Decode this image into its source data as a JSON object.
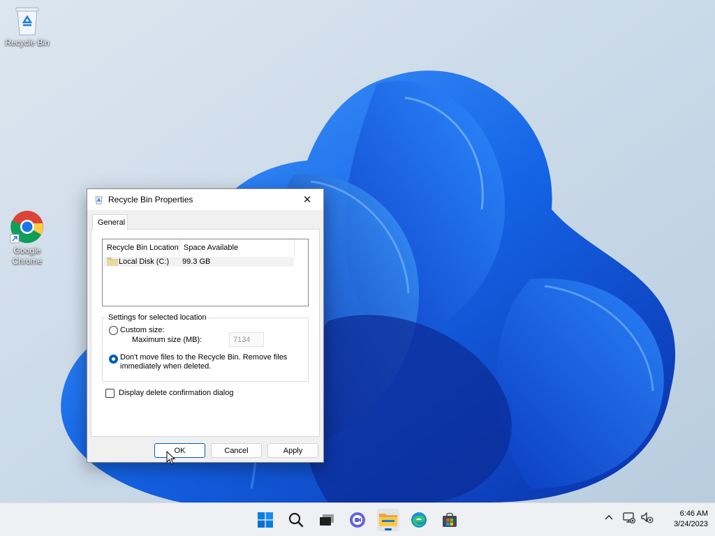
{
  "desktop": {
    "icons": [
      {
        "label": "Recycle Bin",
        "icon": "recycle-bin-icon"
      },
      {
        "label": "Google Chrome",
        "icon": "chrome-icon"
      }
    ]
  },
  "dialog": {
    "title": "Recycle Bin Properties",
    "close_glyph": "✕",
    "tab": "General",
    "list": {
      "columns": [
        "Recycle Bin Location",
        "Space Available"
      ],
      "rows": [
        {
          "location": "Local Disk (C:)",
          "space": "99.3 GB"
        }
      ]
    },
    "settings": {
      "legend": "Settings for selected location",
      "custom_size_label": "Custom size:",
      "max_size_label": "Maximum size (MB):",
      "max_size_value": "7134",
      "dont_move_label": "Don't move files to the Recycle Bin. Remove files immediately when deleted.",
      "selected_option": "dont_move"
    },
    "display_confirm_label": "Display delete confirmation dialog",
    "display_confirm_checked": false,
    "buttons": {
      "ok": "OK",
      "cancel": "Cancel",
      "apply": "Apply"
    }
  },
  "taskbar": {
    "icons": [
      "windows-start-icon",
      "search-icon",
      "task-view-icon",
      "chat-icon",
      "file-explorer-icon",
      "edge-icon",
      "store-icon"
    ],
    "tray": [
      "chevron-up-icon",
      "network-icon",
      "volume-muted-icon"
    ],
    "time": "6:46 AM",
    "date": "3/24/2023"
  },
  "colors": {
    "accent": "#005fb8",
    "wallpaper_base": "#cfdbe8",
    "bloom": "#1a5fe0"
  }
}
